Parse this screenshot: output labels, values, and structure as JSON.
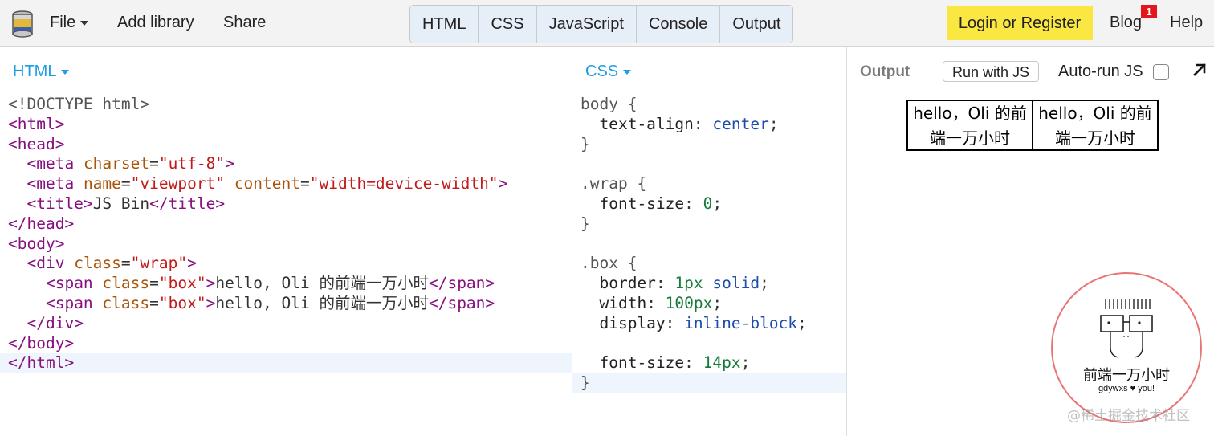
{
  "header": {
    "logo": "jsbin-logo",
    "menu": [
      {
        "label": "File",
        "has_dropdown": true
      },
      {
        "label": "Add library"
      },
      {
        "label": "Share"
      }
    ],
    "tabs": [
      "HTML",
      "CSS",
      "JavaScript",
      "Console",
      "Output"
    ],
    "login_label": "Login or Register",
    "blog_label": "Blog",
    "blog_badge": "1",
    "help_label": "Help"
  },
  "html_panel": {
    "label": "HTML",
    "lines": [
      "<!DOCTYPE html>",
      "<html>",
      "<head>",
      "  <meta charset=\"utf-8\">",
      "  <meta name=\"viewport\" content=\"width=device-width\">",
      "  <title>JS Bin</title>",
      "</head>",
      "<body>",
      "  <div class=\"wrap\">",
      "    <span class=\"box\">hello, Oli 的前端一万小时</span>",
      "    <span class=\"box\">hello, Oli 的前端一万小时</span>",
      "  </div>",
      "</body>",
      "</html>"
    ]
  },
  "css_panel": {
    "label": "CSS",
    "lines": [
      "body {",
      "  text-align: center;",
      "}",
      "",
      ".wrap {",
      "  font-size: 0;",
      "}",
      "",
      ".box {",
      "  border: 1px solid;",
      "  width: 100px;",
      "  display: inline-block;",
      "",
      "  font-size: 14px;",
      "}"
    ]
  },
  "output_panel": {
    "label": "Output",
    "run_button": "Run with JS",
    "autorun_label": "Auto-run JS",
    "autorun_checked": false,
    "preview_boxes": [
      "hello，Oli 的前端一万小时",
      "hello，Oli 的前端一万小时"
    ]
  },
  "badge_circle": {
    "title": "前端一万小时",
    "subtitle": "gdywxs ♥ you!"
  },
  "watermark": "@稀土掘金技术社区",
  "colors": {
    "accent": "#1e9de3",
    "login_bg": "#fbe742",
    "badge_red": "#e4161b",
    "tag": "#880f7f",
    "attr": "#aa5309",
    "string": "#c11a1a"
  }
}
